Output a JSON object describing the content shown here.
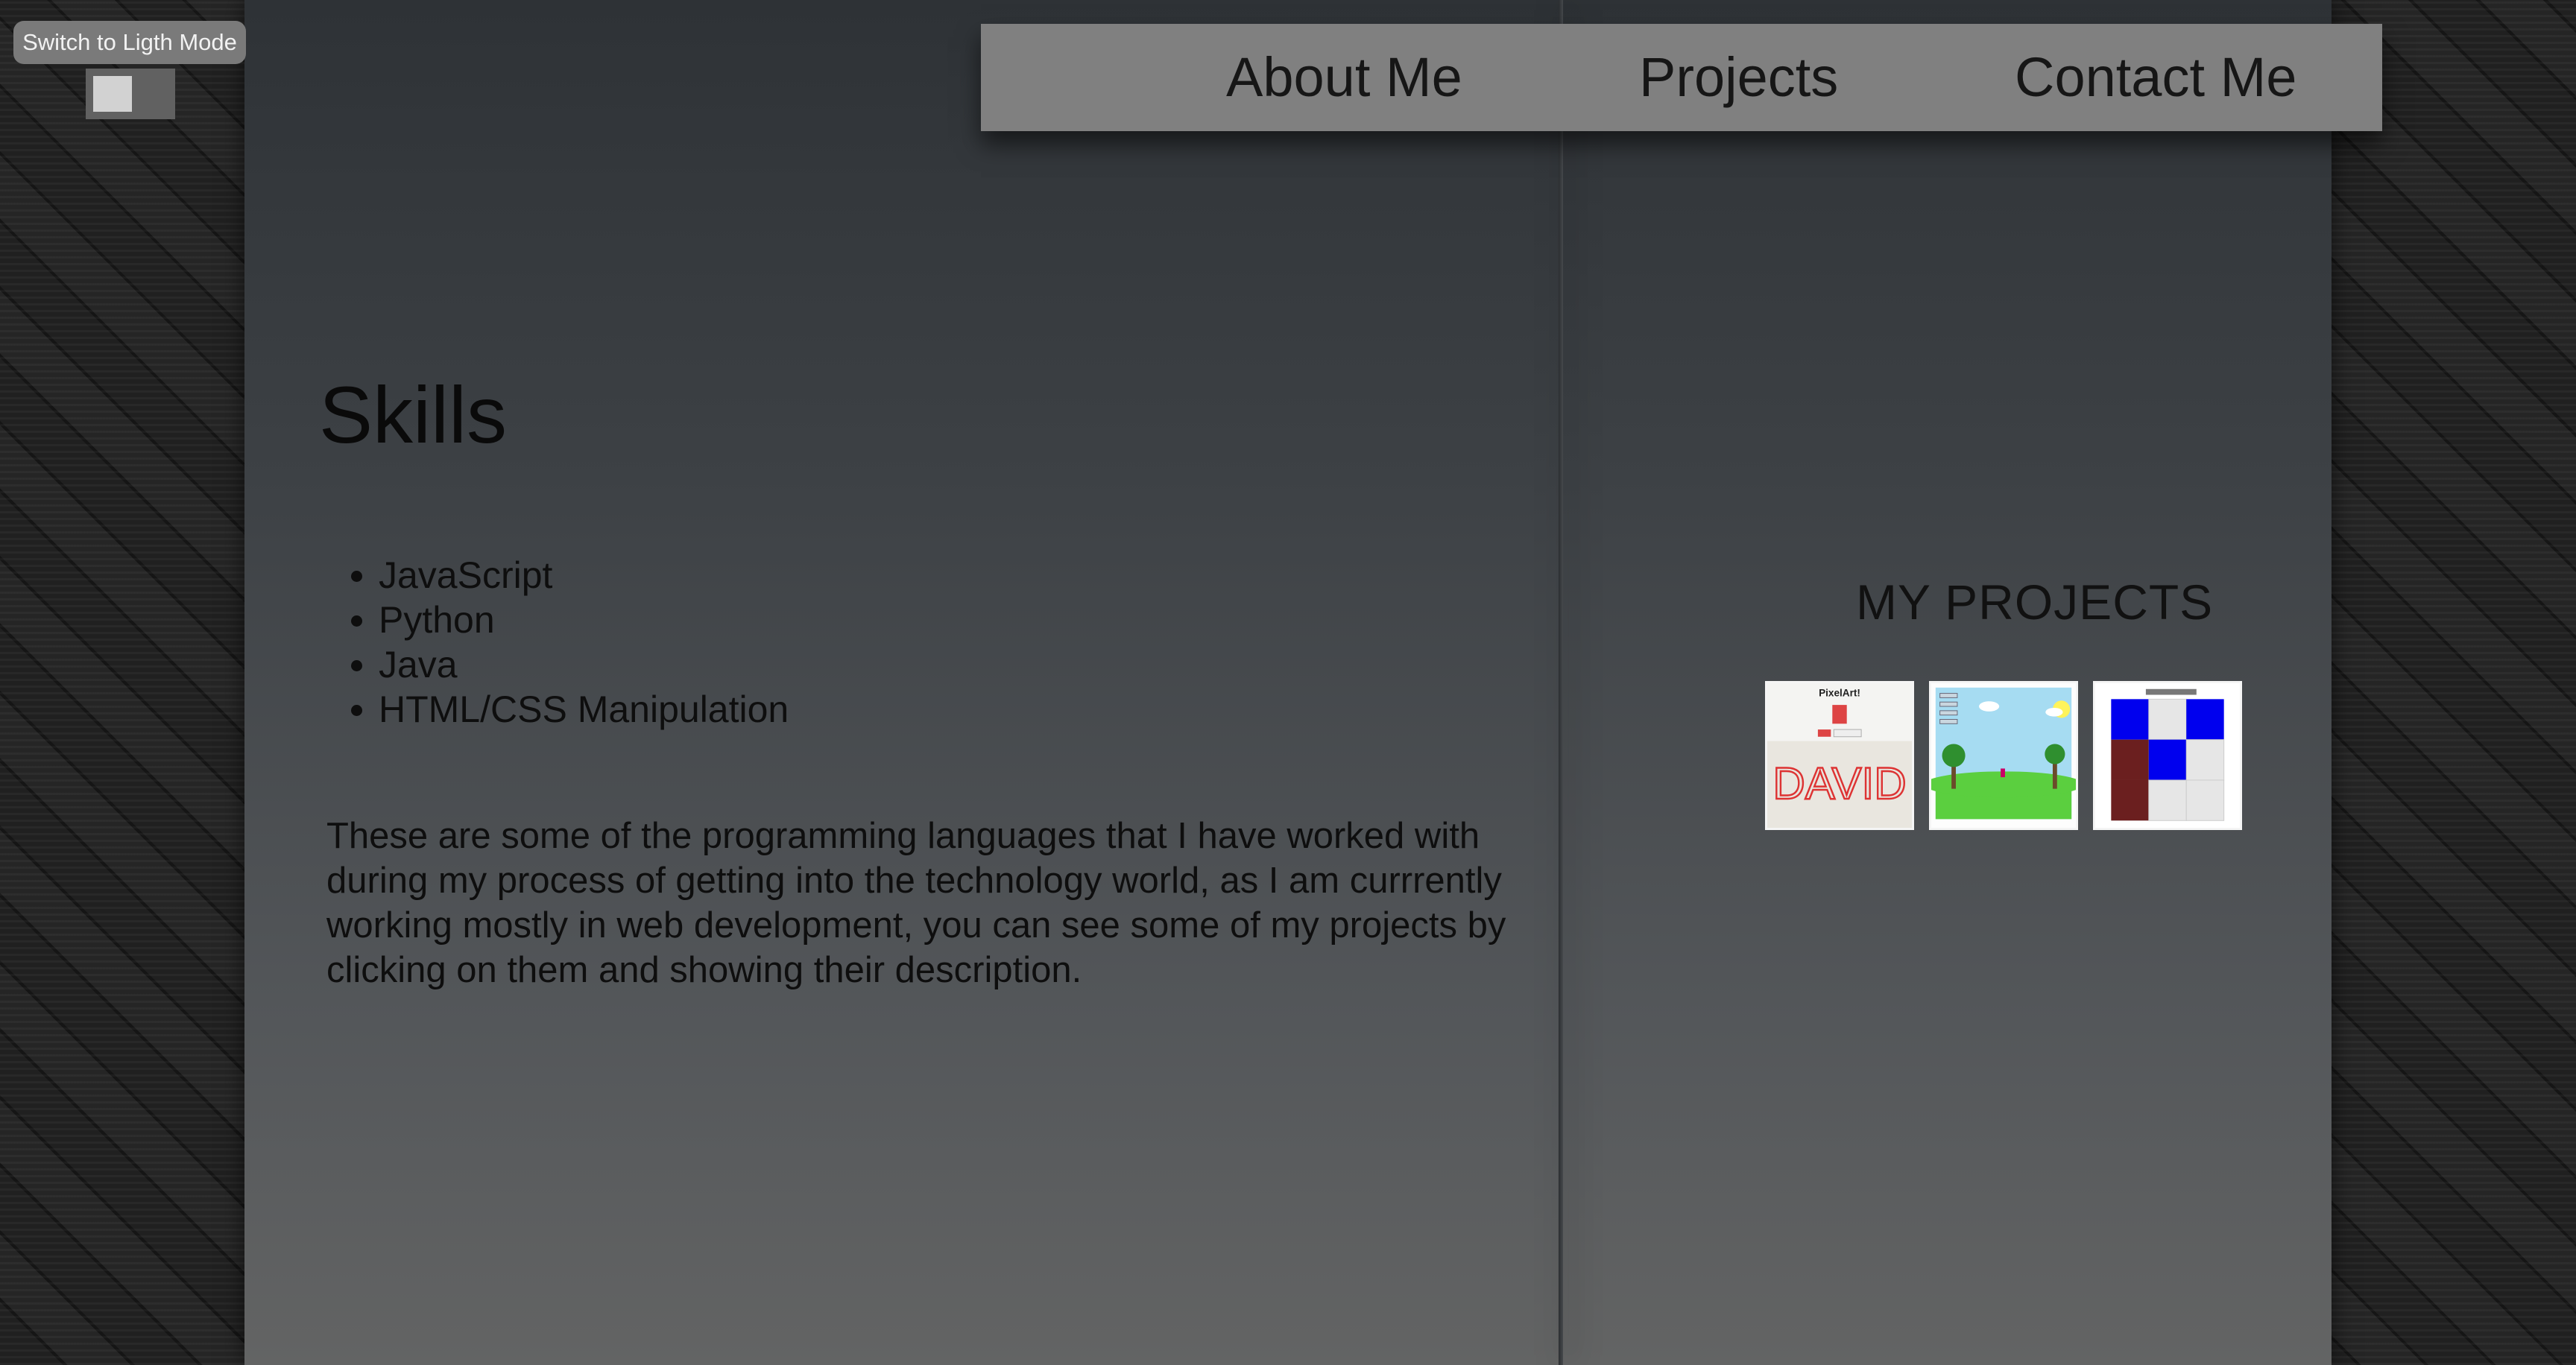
{
  "mode_toggle": {
    "label": "Switch to Ligth Mode"
  },
  "nav": {
    "items": [
      {
        "label": "About Me"
      },
      {
        "label": "Projects"
      },
      {
        "label": "Contact Me"
      }
    ]
  },
  "skills": {
    "title": "Skills",
    "items": [
      "JavaScript",
      "Python",
      "Java",
      "HTML/CSS Manipulation"
    ],
    "description": "These are some of the programming languages that I have worked with during my process of getting into the technology world, as I am currrently working mostly in web development, you can see some of my projects by clicking on them and showing their description."
  },
  "projects": {
    "title": "MY PROJECTS",
    "thumbnails": [
      {
        "icon": "pixel-art-thumbnail",
        "caption": "PixelArt!",
        "drawing": "DAVID"
      },
      {
        "icon": "landscape-game-thumbnail"
      },
      {
        "icon": "color-grid-thumbnail"
      }
    ]
  }
}
